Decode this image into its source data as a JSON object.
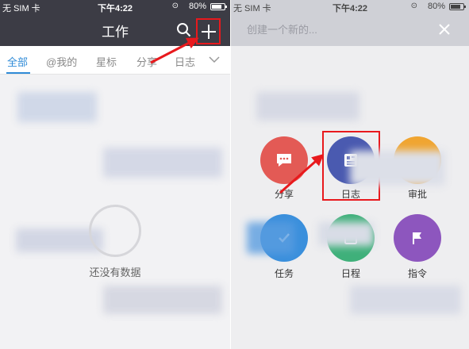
{
  "status_bar": {
    "carrier": "无 SIM 卡",
    "time": "下午4:22",
    "battery": "80%"
  },
  "left": {
    "nav_title": "工作",
    "tabs": [
      {
        "label": "全部",
        "active": true
      },
      {
        "label": "@我的",
        "active": false
      },
      {
        "label": "星标",
        "active": false
      },
      {
        "label": "分享",
        "active": false
      },
      {
        "label": "日志",
        "active": false
      }
    ],
    "empty_text": "还没有数据",
    "icons": {
      "search": "search-icon",
      "add": "plus-icon",
      "more": "chevron-down-icon"
    }
  },
  "right": {
    "create_placeholder": "创建一个新的...",
    "apps": [
      {
        "label": "分享",
        "color": "#e35a55",
        "icon": "chat-bubble-icon"
      },
      {
        "label": "日志",
        "color": "#4a5ab0",
        "icon": "document-icon"
      },
      {
        "label": "审批",
        "color": "#f0a531",
        "icon": "approval-icon"
      },
      {
        "label": "任务",
        "color": "#3a8fdc",
        "icon": "task-icon"
      },
      {
        "label": "日程",
        "color": "#3fb07a",
        "icon": "calendar-icon"
      },
      {
        "label": "指令",
        "color": "#8d56be",
        "icon": "flag-icon"
      }
    ]
  },
  "colors": {
    "header_dark": "#3c3c45",
    "accent_blue": "#2f8bd7",
    "annotation_red": "#e8191d"
  }
}
